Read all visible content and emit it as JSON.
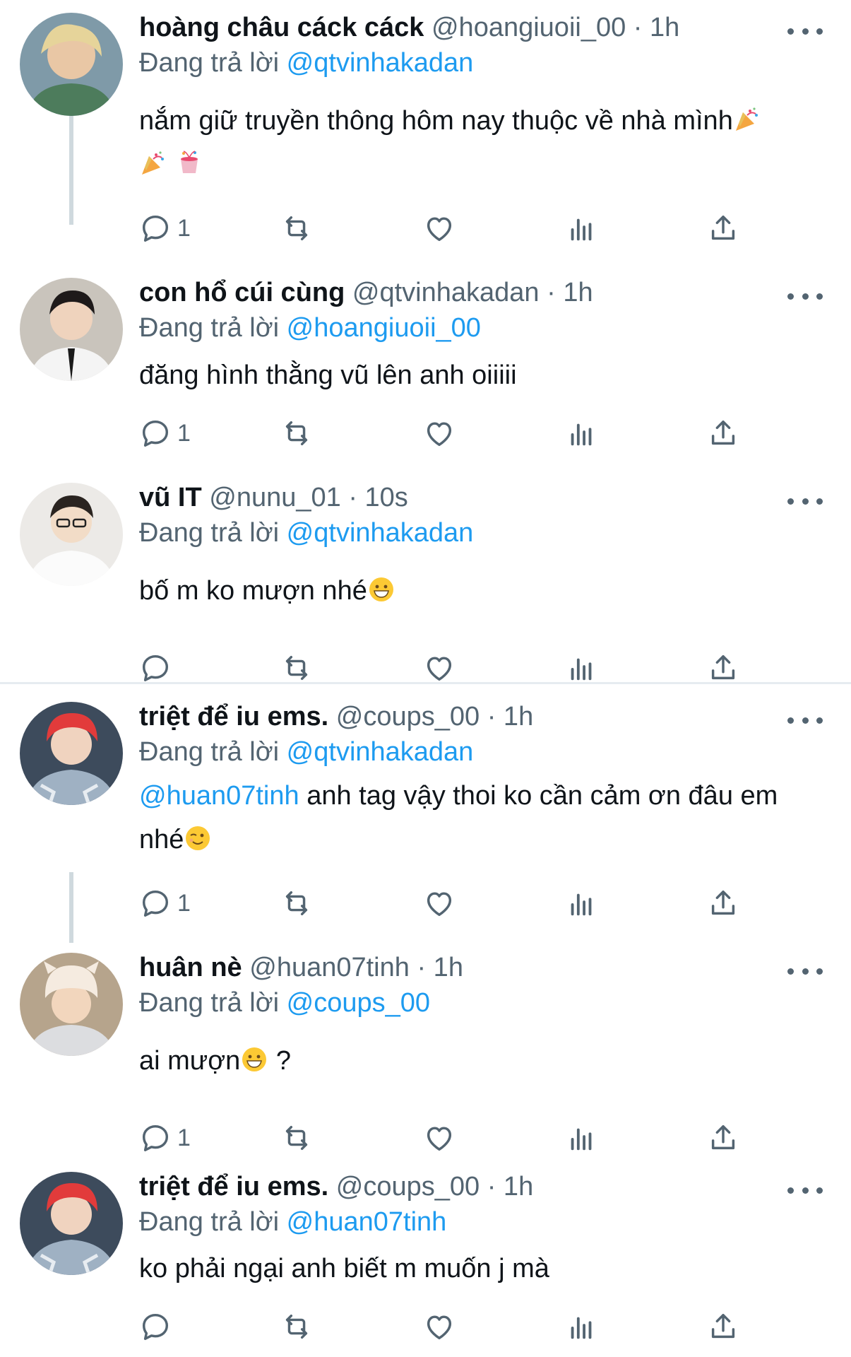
{
  "reply_prefix": "Đang trả lời",
  "tweets": [
    {
      "name": "hoàng châu cáck cáck",
      "handle": "@hoangiuoii_00",
      "time": "· 1h",
      "reply_to": "@qtvinhakadan",
      "text": "nắm giữ truyền thông hôm nay thuộc về nhà mình",
      "reply_count": "1"
    },
    {
      "name": "con hổ cúi cùng",
      "handle": "@qtvinhakadan",
      "time": "· 1h",
      "reply_to": "@hoangiuoii_00",
      "text": "đăng hình thằng vũ lên anh oiiiii",
      "reply_count": "1"
    },
    {
      "name": "vũ IT",
      "handle": "@nunu_01",
      "time": "· 10s",
      "reply_to": "@qtvinhakadan",
      "text": "bố m ko mượn nhé",
      "reply_count": ""
    },
    {
      "name": "triệt để iu ems.",
      "handle": "@coups_00",
      "time": "· 1h",
      "reply_to": "@qtvinhakadan",
      "text_mention": "@huan07tinh",
      "text": " anh tag vậy thoi ko cần cảm ơn đâu em nhé",
      "reply_count": "1"
    },
    {
      "name": "huân nè",
      "handle": "@huan07tinh",
      "time": "· 1h",
      "reply_to": "@coups_00",
      "text": "ai mượn",
      "text_after": " ?",
      "reply_count": "1"
    },
    {
      "name": "triệt để iu ems.",
      "handle": "@coups_00",
      "time": "· 1h",
      "reply_to": "@huan07tinh",
      "text": "ko phải ngại anh biết m muốn j mà",
      "reply_count": ""
    }
  ],
  "icons": {
    "reply": "reply-icon",
    "retweet": "retweet-icon",
    "like": "heart-icon",
    "views": "views-icon",
    "share": "share-icon",
    "more": "more-icon"
  },
  "colors": {
    "link": "#1d9bf0",
    "secondary_text": "#536471",
    "thread_line": "#cfd9de"
  }
}
